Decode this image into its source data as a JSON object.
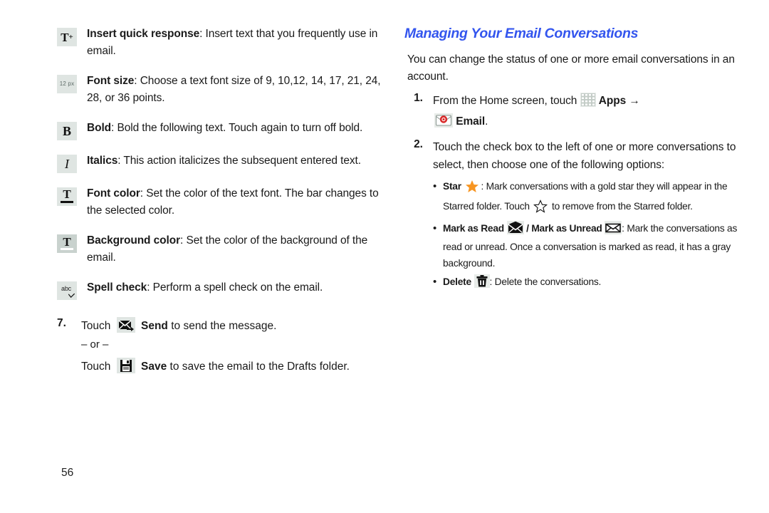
{
  "page": {
    "number": "56",
    "heading_color": "#3355ee",
    "star_color": "#f79521",
    "chip_bg": "#dfe5e2"
  },
  "left_column": {
    "definitions": [
      {
        "icon": "insert-quick-response-icon",
        "icon_label": "T+",
        "term": "Insert quick response",
        "sep": ": ",
        "desc": "Insert text that you frequently use in email."
      },
      {
        "icon": "font-size-icon",
        "icon_label": "12 px",
        "term": "Font size",
        "sep": ": ",
        "desc": "Choose a text font size of 9, 10,12, 14, 17, 21, 24, 28, or 36 points."
      },
      {
        "icon": "bold-icon",
        "icon_label": "B",
        "term": "Bold",
        "sep": ": ",
        "desc": "Bold the following text. Touch again to turn off bold."
      },
      {
        "icon": "italics-icon",
        "icon_label": "I",
        "term": "Italics",
        "sep": ": ",
        "desc": "This action italicizes the subsequent entered text."
      },
      {
        "icon": "font-color-icon",
        "icon_label": "T",
        "term": "Font color",
        "sep": ": ",
        "desc": "Set the color of the text font. The bar changes to the selected color."
      },
      {
        "icon": "background-color-icon",
        "icon_label": "T",
        "term": "Background color",
        "sep": ": ",
        "desc": "Set the color of the background of the email."
      },
      {
        "icon": "spell-check-icon",
        "icon_label": "abc",
        "term": "Spell check",
        "sep": ": ",
        "desc": "Perform a spell check on the email."
      }
    ],
    "step7": {
      "number": "7.",
      "touch_label_1": "Touch",
      "send_icon": "send-icon",
      "send_term": "Send",
      "send_rest": " to send the message.",
      "or_text": "– or –",
      "touch_label_2": "Touch",
      "save_icon": "save-icon",
      "save_term": "Save",
      "save_rest": " to save the email to the Drafts folder."
    }
  },
  "right_column": {
    "heading": "Managing Your Email Conversations",
    "intro": "You can change the status of one or more email conversations in an account.",
    "steps": [
      {
        "number": "1.",
        "pre": "From the Home screen, touch ",
        "apps_icon": "apps-grid-icon",
        "apps_label": "Apps",
        "arrow": "→",
        "email_icon": "email-icon",
        "email_label": "Email",
        "post": "."
      },
      {
        "number": "2.",
        "text": "Touch the check box to the left of one or more conversations to select, then choose one of the following options:"
      }
    ],
    "bullets": [
      {
        "name": "bullet-star",
        "term": "Star",
        "icon": "star-filled-icon",
        "text_1": ": Mark conversations with a gold star they will appear in the Starred folder. Touch ",
        "icon_2": "star-outline-icon",
        "text_2": " to remove from the Starred folder."
      },
      {
        "name": "bullet-mark-read-unread",
        "term": "Mark as Read",
        "icon": "envelope-open-icon",
        "separator": " / ",
        "term_2": "Mark as Unread",
        "icon_2": "envelope-closed-icon",
        "text": ": Mark the conversations as read or unread. Once a conversation is marked as read, it has a gray background."
      },
      {
        "name": "bullet-delete",
        "term": "Delete",
        "icon": "trash-icon",
        "text": ": Delete the conversations."
      }
    ]
  }
}
